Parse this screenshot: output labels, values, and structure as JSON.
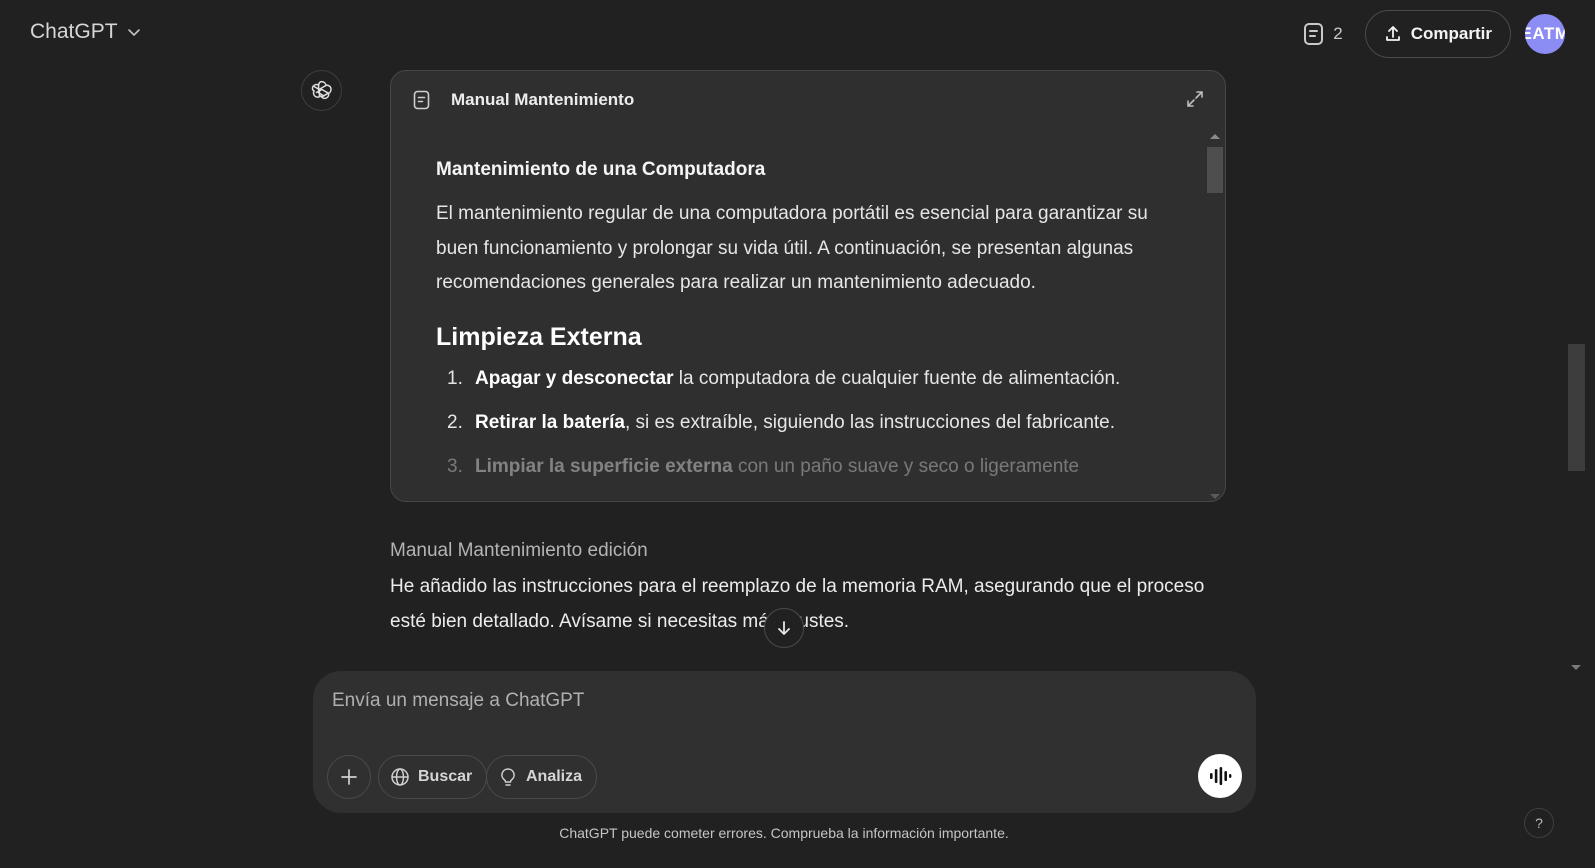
{
  "header": {
    "model_name": "ChatGPT",
    "doc_count": "2",
    "share_label": "Compartir",
    "avatar_initials": "EATM"
  },
  "canvas": {
    "title": "Manual Mantenimiento",
    "heading": "Mantenimiento de una Computadora",
    "intro": "El mantenimiento regular de una computadora portátil es esencial para garantizar su buen funcionamiento y prolongar su vida útil. A continuación, se presentan algunas recomendaciones generales para realizar un mantenimiento adecuado.",
    "section_title": "Limpieza Externa",
    "list": [
      {
        "num": "1.",
        "bold": "Apagar y desconectar",
        "rest": " la computadora de cualquier fuente de alimentación."
      },
      {
        "num": "2.",
        "bold": "Retirar la batería",
        "rest": ", si es extraíble, siguiendo las instrucciones del fabricante."
      },
      {
        "num": "3.",
        "bold": "Limpiar la superficie externa",
        "rest": " con un paño suave y seco o ligeramente"
      }
    ]
  },
  "message": {
    "edit_label": "Manual Mantenimiento edición",
    "text": "He añadido las instrucciones para el reemplazo de la memoria RAM, asegurando que el proceso esté bien detallado. Avísame si necesitas más ajustes."
  },
  "composer": {
    "placeholder": "Envía un mensaje a ChatGPT",
    "search_label": "Buscar",
    "analyze_label": "Analiza"
  },
  "footer": {
    "disclaimer": "ChatGPT puede cometer errores. Comprueba la información importante.",
    "help": "?"
  },
  "icons": {
    "model_chevron": "chevron-down-icon",
    "doc": "document-icon",
    "share": "upload-icon",
    "assistant": "openai-logo-icon",
    "expand": "expand-icon",
    "scroll_down": "arrow-down-icon",
    "plus": "plus-icon",
    "globe": "globe-icon",
    "bulb": "lightbulb-icon",
    "voice": "voice-waveform-icon"
  },
  "colors": {
    "background": "#212121",
    "card": "#2f2f2f",
    "composer": "#303030",
    "avatar": "#8c8cf5"
  }
}
